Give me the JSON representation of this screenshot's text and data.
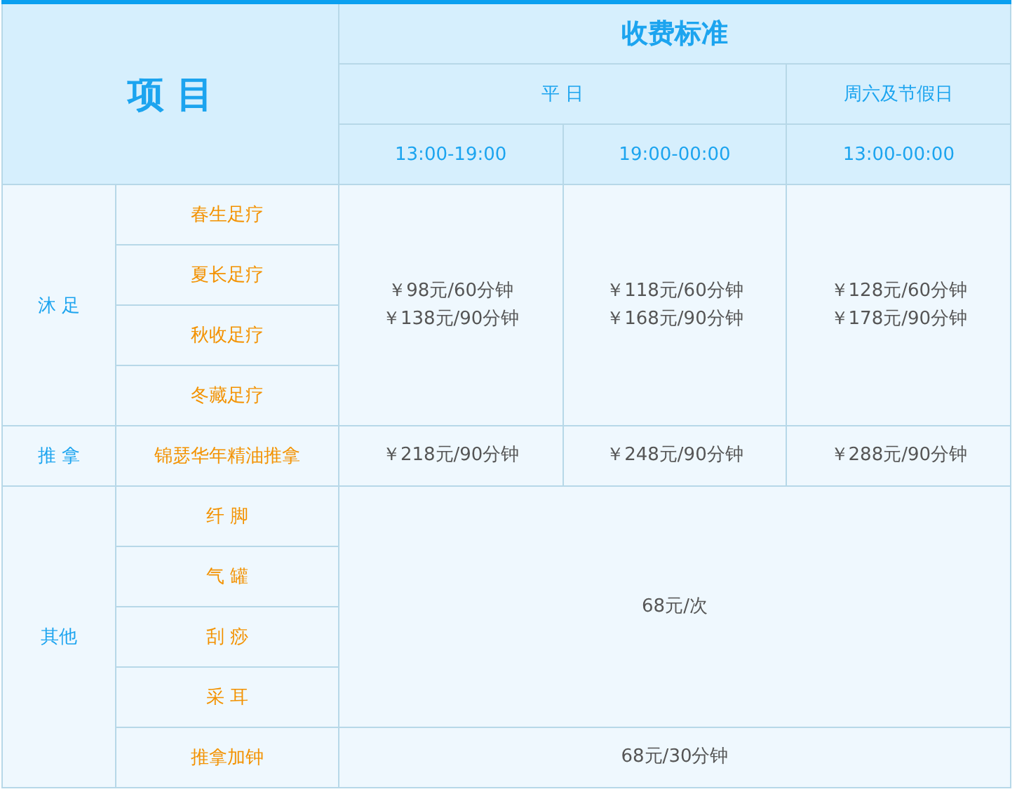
{
  "header": {
    "item_label": "项 目",
    "title": "收费标准",
    "periods": [
      {
        "label": "平 日",
        "slots": [
          "13:00-19:00",
          "19:00-00:00"
        ]
      },
      {
        "label": "周六及节假日",
        "slots": [
          "13:00-00:00"
        ]
      }
    ]
  },
  "groups": [
    {
      "category": "沐 足",
      "sections": [
        {
          "items": [
            "春生足疗",
            "夏长足疗",
            "秋收足疗",
            "冬藏足疗"
          ],
          "prices": [
            {
              "lines": [
                "￥98元/60分钟",
                "￥138元/90分钟"
              ]
            },
            {
              "lines": [
                "￥118元/60分钟",
                "￥168元/90分钟"
              ]
            },
            {
              "lines": [
                "￥128元/60分钟",
                "￥178元/90分钟"
              ]
            }
          ]
        }
      ]
    },
    {
      "category": "推 拿",
      "sections": [
        {
          "items": [
            "锦瑟华年精油推拿"
          ],
          "prices": [
            {
              "lines": [
                "￥218元/90分钟"
              ]
            },
            {
              "lines": [
                "￥248元/90分钟"
              ]
            },
            {
              "lines": [
                "￥288元/90分钟"
              ]
            }
          ]
        }
      ]
    },
    {
      "category": "其他",
      "sections": [
        {
          "items": [
            "纤 脚",
            "气 罐",
            "刮 痧",
            "采 耳"
          ],
          "prices": [
            {
              "lines": [
                "68元/次"
              ]
            }
          ]
        },
        {
          "items": [
            "推拿加钟"
          ],
          "prices": [
            {
              "lines": [
                "68元/30分钟"
              ]
            }
          ]
        }
      ]
    }
  ]
}
